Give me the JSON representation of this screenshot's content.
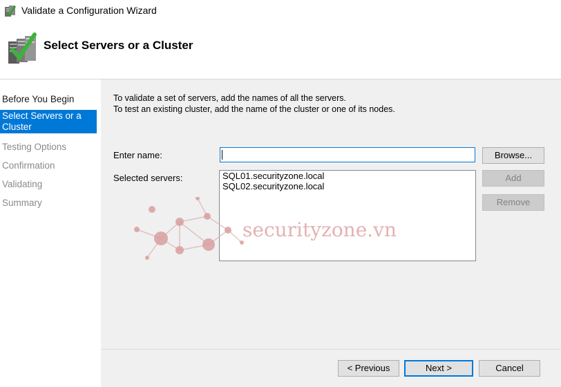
{
  "window": {
    "title": "Validate a Configuration Wizard"
  },
  "header": {
    "title": "Select Servers or a Cluster"
  },
  "steps": [
    {
      "label": "Before You Begin",
      "state": "done"
    },
    {
      "label": "Select Servers or a Cluster",
      "state": "active"
    },
    {
      "label": "Testing Options",
      "state": "pending"
    },
    {
      "label": "Confirmation",
      "state": "pending"
    },
    {
      "label": "Validating",
      "state": "pending"
    },
    {
      "label": "Summary",
      "state": "pending"
    }
  ],
  "intro": {
    "line1": "To validate a set of servers, add the names of all the servers.",
    "line2": "To test an existing cluster, add the name of the cluster or one of its nodes."
  },
  "form": {
    "enter_name_label": "Enter name:",
    "enter_name_value": "",
    "selected_servers_label": "Selected servers:",
    "selected_servers": [
      "SQL01.securityzone.local",
      "SQL02.securityzone.local"
    ]
  },
  "buttons": {
    "browse": "Browse...",
    "add": "Add",
    "remove": "Remove"
  },
  "footer": {
    "previous": "< Previous",
    "next": "Next >",
    "cancel": "Cancel"
  },
  "watermark": {
    "text": "securityzone.vn"
  },
  "colors": {
    "accent": "#0078d7",
    "watermark": "#d9a0a0",
    "panel": "#f0f0f0"
  },
  "icons": {
    "app": "cluster-validate-icon",
    "header": "cluster-check-icon"
  }
}
